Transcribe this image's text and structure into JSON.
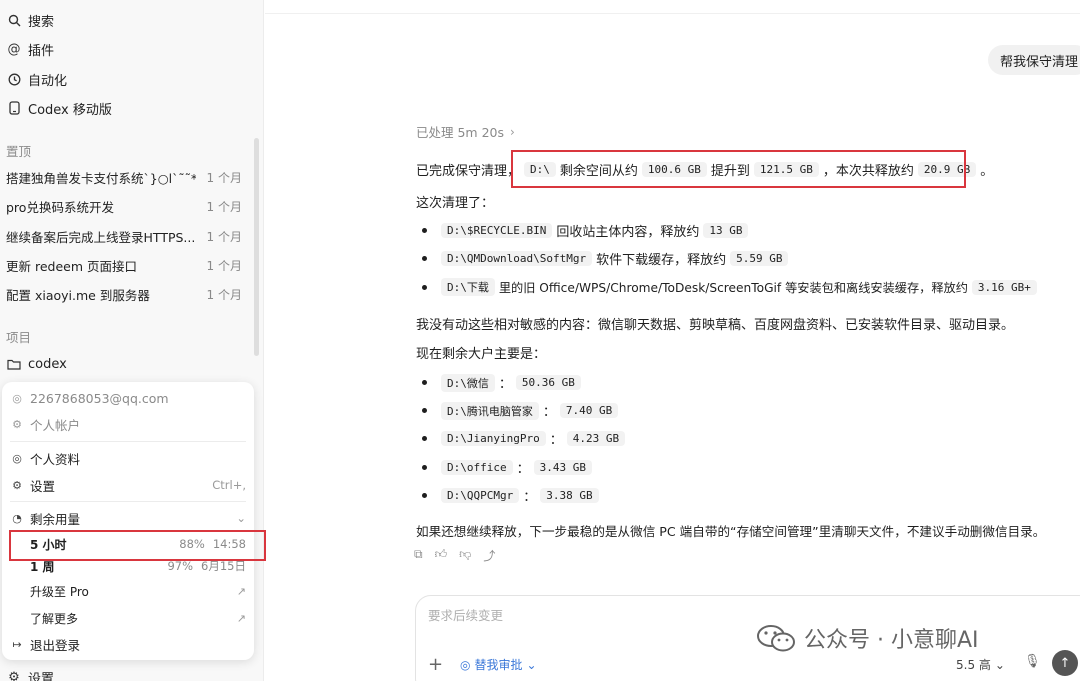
{
  "sidebar": {
    "nav": [
      {
        "label": "搜索",
        "icon": "search-icon"
      },
      {
        "label": "插件",
        "icon": "at-icon"
      },
      {
        "label": "自动化",
        "icon": "clock-icon"
      },
      {
        "label": "Codex 移动版",
        "icon": "phone-icon"
      }
    ],
    "pinned_label": "置顶",
    "pinned": [
      {
        "title": "搭建独角兽发卡支付系统`}○l`˜˜**",
        "time": "1 个月"
      },
      {
        "title": "pro兑换码系统开发",
        "time": "1 个月"
      },
      {
        "title": "继续备案后完成上线登录HTTPS...",
        "time": "1 个月"
      },
      {
        "title": "更新 redeem 页面接口",
        "time": "1 个月"
      },
      {
        "title": "配置 xiaoyi.me 到服务器",
        "time": "1 个月"
      }
    ],
    "projects_label": "项目",
    "project": {
      "label": "codex",
      "icon": "folder-icon"
    },
    "bottom_settings": "设置"
  },
  "account_menu": {
    "email": "2267868053@qq.com",
    "account": "个人帐户",
    "profile": "个人资料",
    "settings": "设置",
    "settings_shortcut": "Ctrl+,",
    "usage_label": "剩余用量",
    "usage": [
      {
        "label": "5 小时",
        "percent": "88%",
        "reset": "14:58"
      },
      {
        "label": "1 周",
        "percent": "97%",
        "reset": "6月15日"
      }
    ],
    "upgrade": "升级至 Pro",
    "learn_more": "了解更多",
    "logout": "退出登录"
  },
  "chat": {
    "user_message": "帮我保守清理",
    "processed": "已处理 5m 20s",
    "summary": {
      "prefix": "已完成保守清理，",
      "drive": "D:\\",
      "t1": "剩余空间从约",
      "from": "100.6 GB",
      "t2": "提升到",
      "to": "121.5 GB",
      "t3": "，本次共释放约",
      "freed": "20.9 GB",
      "t4": "。"
    },
    "cleaned_intro": "这次清理了：",
    "cleaned": [
      {
        "path": "D:\\$RECYCLE.BIN",
        "desc": "回收站主体内容，释放约",
        "size": "13 GB",
        "tail": ""
      },
      {
        "path": "D:\\QMDownload\\SoftMgr",
        "desc": "软件下载缓存，释放约",
        "size": "5.59 GB",
        "tail": ""
      },
      {
        "path": "D:\\下载",
        "desc": "里的旧 Office/WPS/Chrome/ToDesk/ScreenToGif 等安装包和离线安装缓存，释放约",
        "size": "3.16 GB+",
        "tail": ""
      }
    ],
    "untouched": "我没有动这些相对敏感的内容：微信聊天数据、剪映草稿、百度网盘资料、已安装软件目录、驱动目录。",
    "remaining_intro": "现在剩余大户主要是：",
    "remaining": [
      {
        "path": "D:\\微信",
        "size": "50.36 GB"
      },
      {
        "path": "D:\\腾讯电脑管家",
        "size": "7.40 GB"
      },
      {
        "path": "D:\\JianyingPro",
        "size": "4.23 GB"
      },
      {
        "path": "D:\\office",
        "size": "3.43 GB"
      },
      {
        "path": "D:\\QQPCMgr",
        "size": "3.38 GB"
      }
    ],
    "advice": "如果还想继续释放，下一步最稳的是从微信 PC 端自带的“存储空间管理”里清聊天文件，不建议手动删微信目录。"
  },
  "composer": {
    "placeholder": "要求后续变更",
    "approval": "替我审批",
    "model": "5.5 高"
  },
  "watermark": "公众号 · 小意聊AI",
  "colors": {
    "highlight": "#d9363e",
    "link": "#3a77d8"
  }
}
